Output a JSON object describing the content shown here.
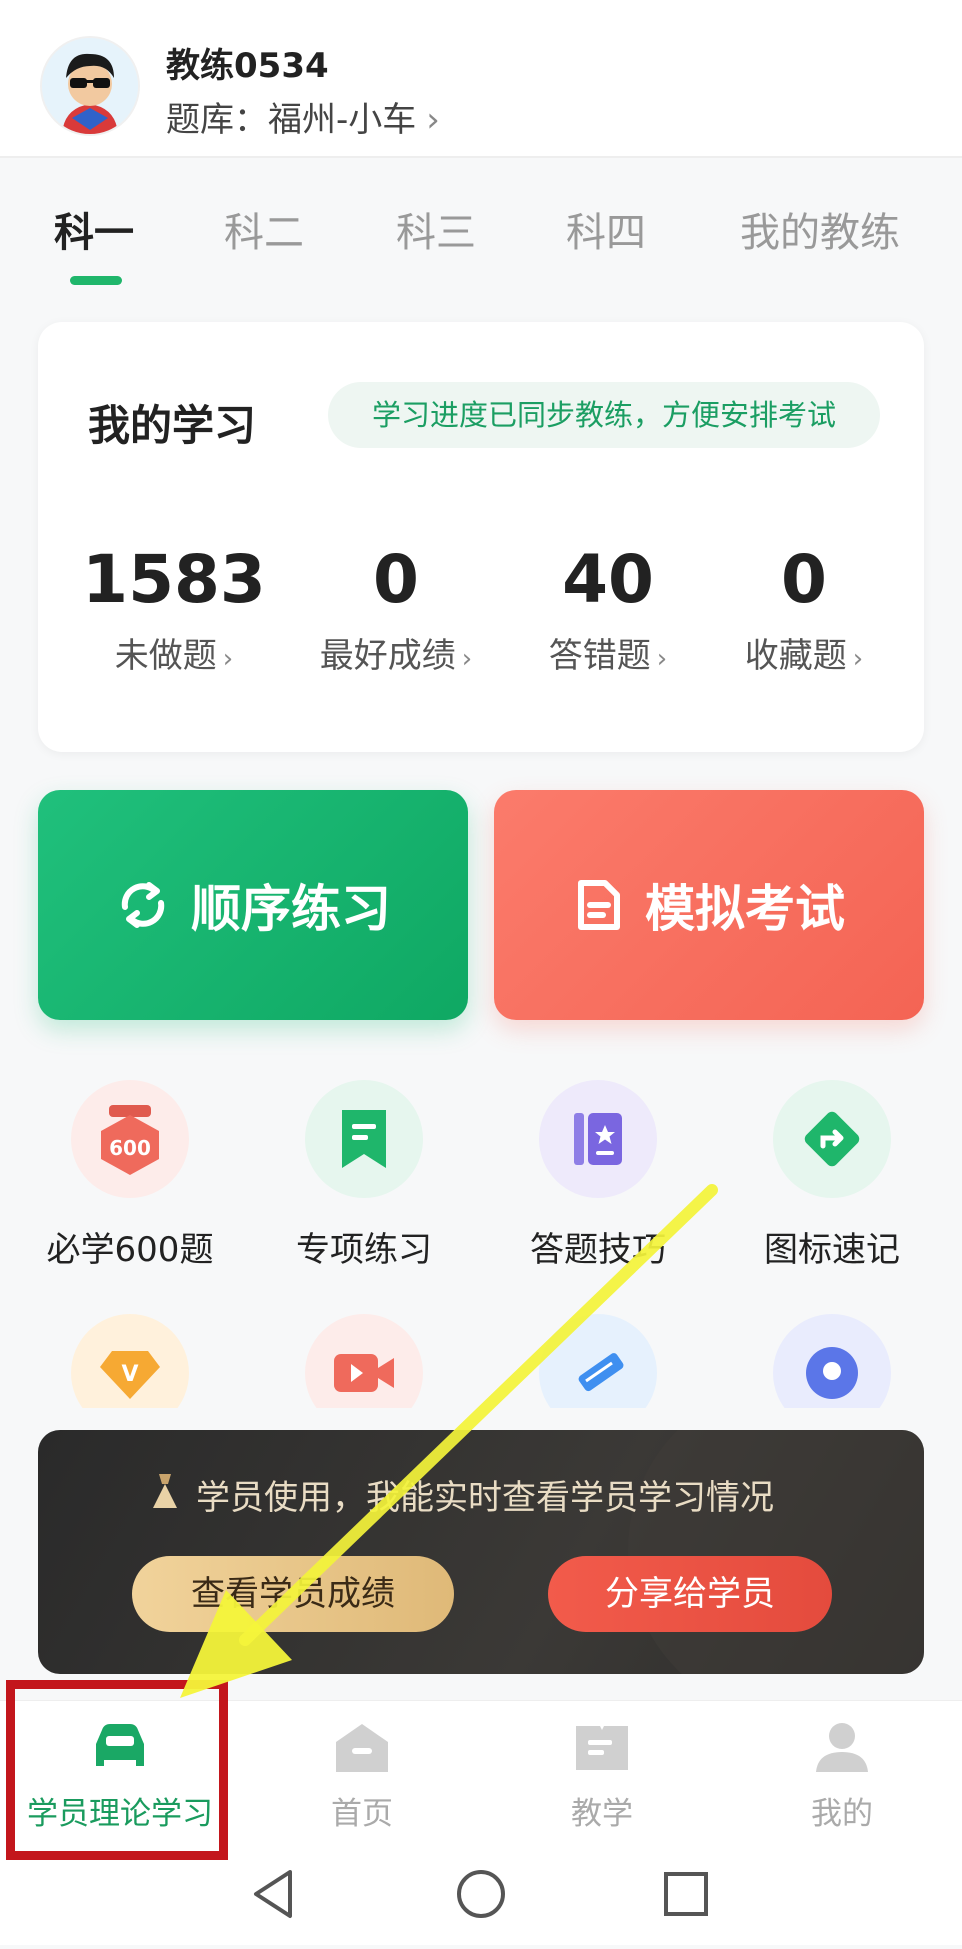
{
  "header": {
    "coach_name": "教练0534",
    "bank_label": "题库：福州-小车",
    "chevron": "›"
  },
  "tabs": [
    "科一",
    "科二",
    "科三",
    "科四",
    "我的教练"
  ],
  "active_tab": "科一",
  "study": {
    "title": "我的学习",
    "sync_note": "学习进度已同步教练，方便安排考试",
    "stats": [
      {
        "value": "1583",
        "label": "未做题"
      },
      {
        "value": "0",
        "label": "最好成绩"
      },
      {
        "value": "40",
        "label": "答错题"
      },
      {
        "value": "0",
        "label": "收藏题"
      }
    ],
    "chevron": "›"
  },
  "buttons": {
    "sequential": "顺序练习",
    "mock_exam": "模拟考试"
  },
  "features": [
    {
      "label": "必学600题",
      "icon": "badge-600-icon",
      "badge_text": "600"
    },
    {
      "label": "专项练习",
      "icon": "bookmark-icon"
    },
    {
      "label": "答题技巧",
      "icon": "star-book-icon"
    },
    {
      "label": "图标速记",
      "icon": "road-sign-icon"
    }
  ],
  "features_row2": [
    {
      "icon": "vip-diamond-icon",
      "badge_text": "V"
    },
    {
      "icon": "video-icon"
    },
    {
      "icon": "pencil-icon"
    },
    {
      "icon": "location-icon"
    }
  ],
  "banner": {
    "text": "学员使用，我能实时查看学员学习情况",
    "view_scores": "查看学员成绩",
    "share": "分享给学员"
  },
  "nav": [
    {
      "label": "学员理论学习",
      "icon": "car-icon",
      "active": true
    },
    {
      "label": "首页",
      "icon": "home-icon",
      "active": false
    },
    {
      "label": "教学",
      "icon": "book-icon",
      "active": false
    },
    {
      "label": "我的",
      "icon": "user-icon",
      "active": false
    }
  ],
  "colors": {
    "accent_green": "#1fb66b",
    "accent_red": "#f46454",
    "annotation_red": "#c3161c",
    "annotation_yellow": "#f4f43a"
  }
}
